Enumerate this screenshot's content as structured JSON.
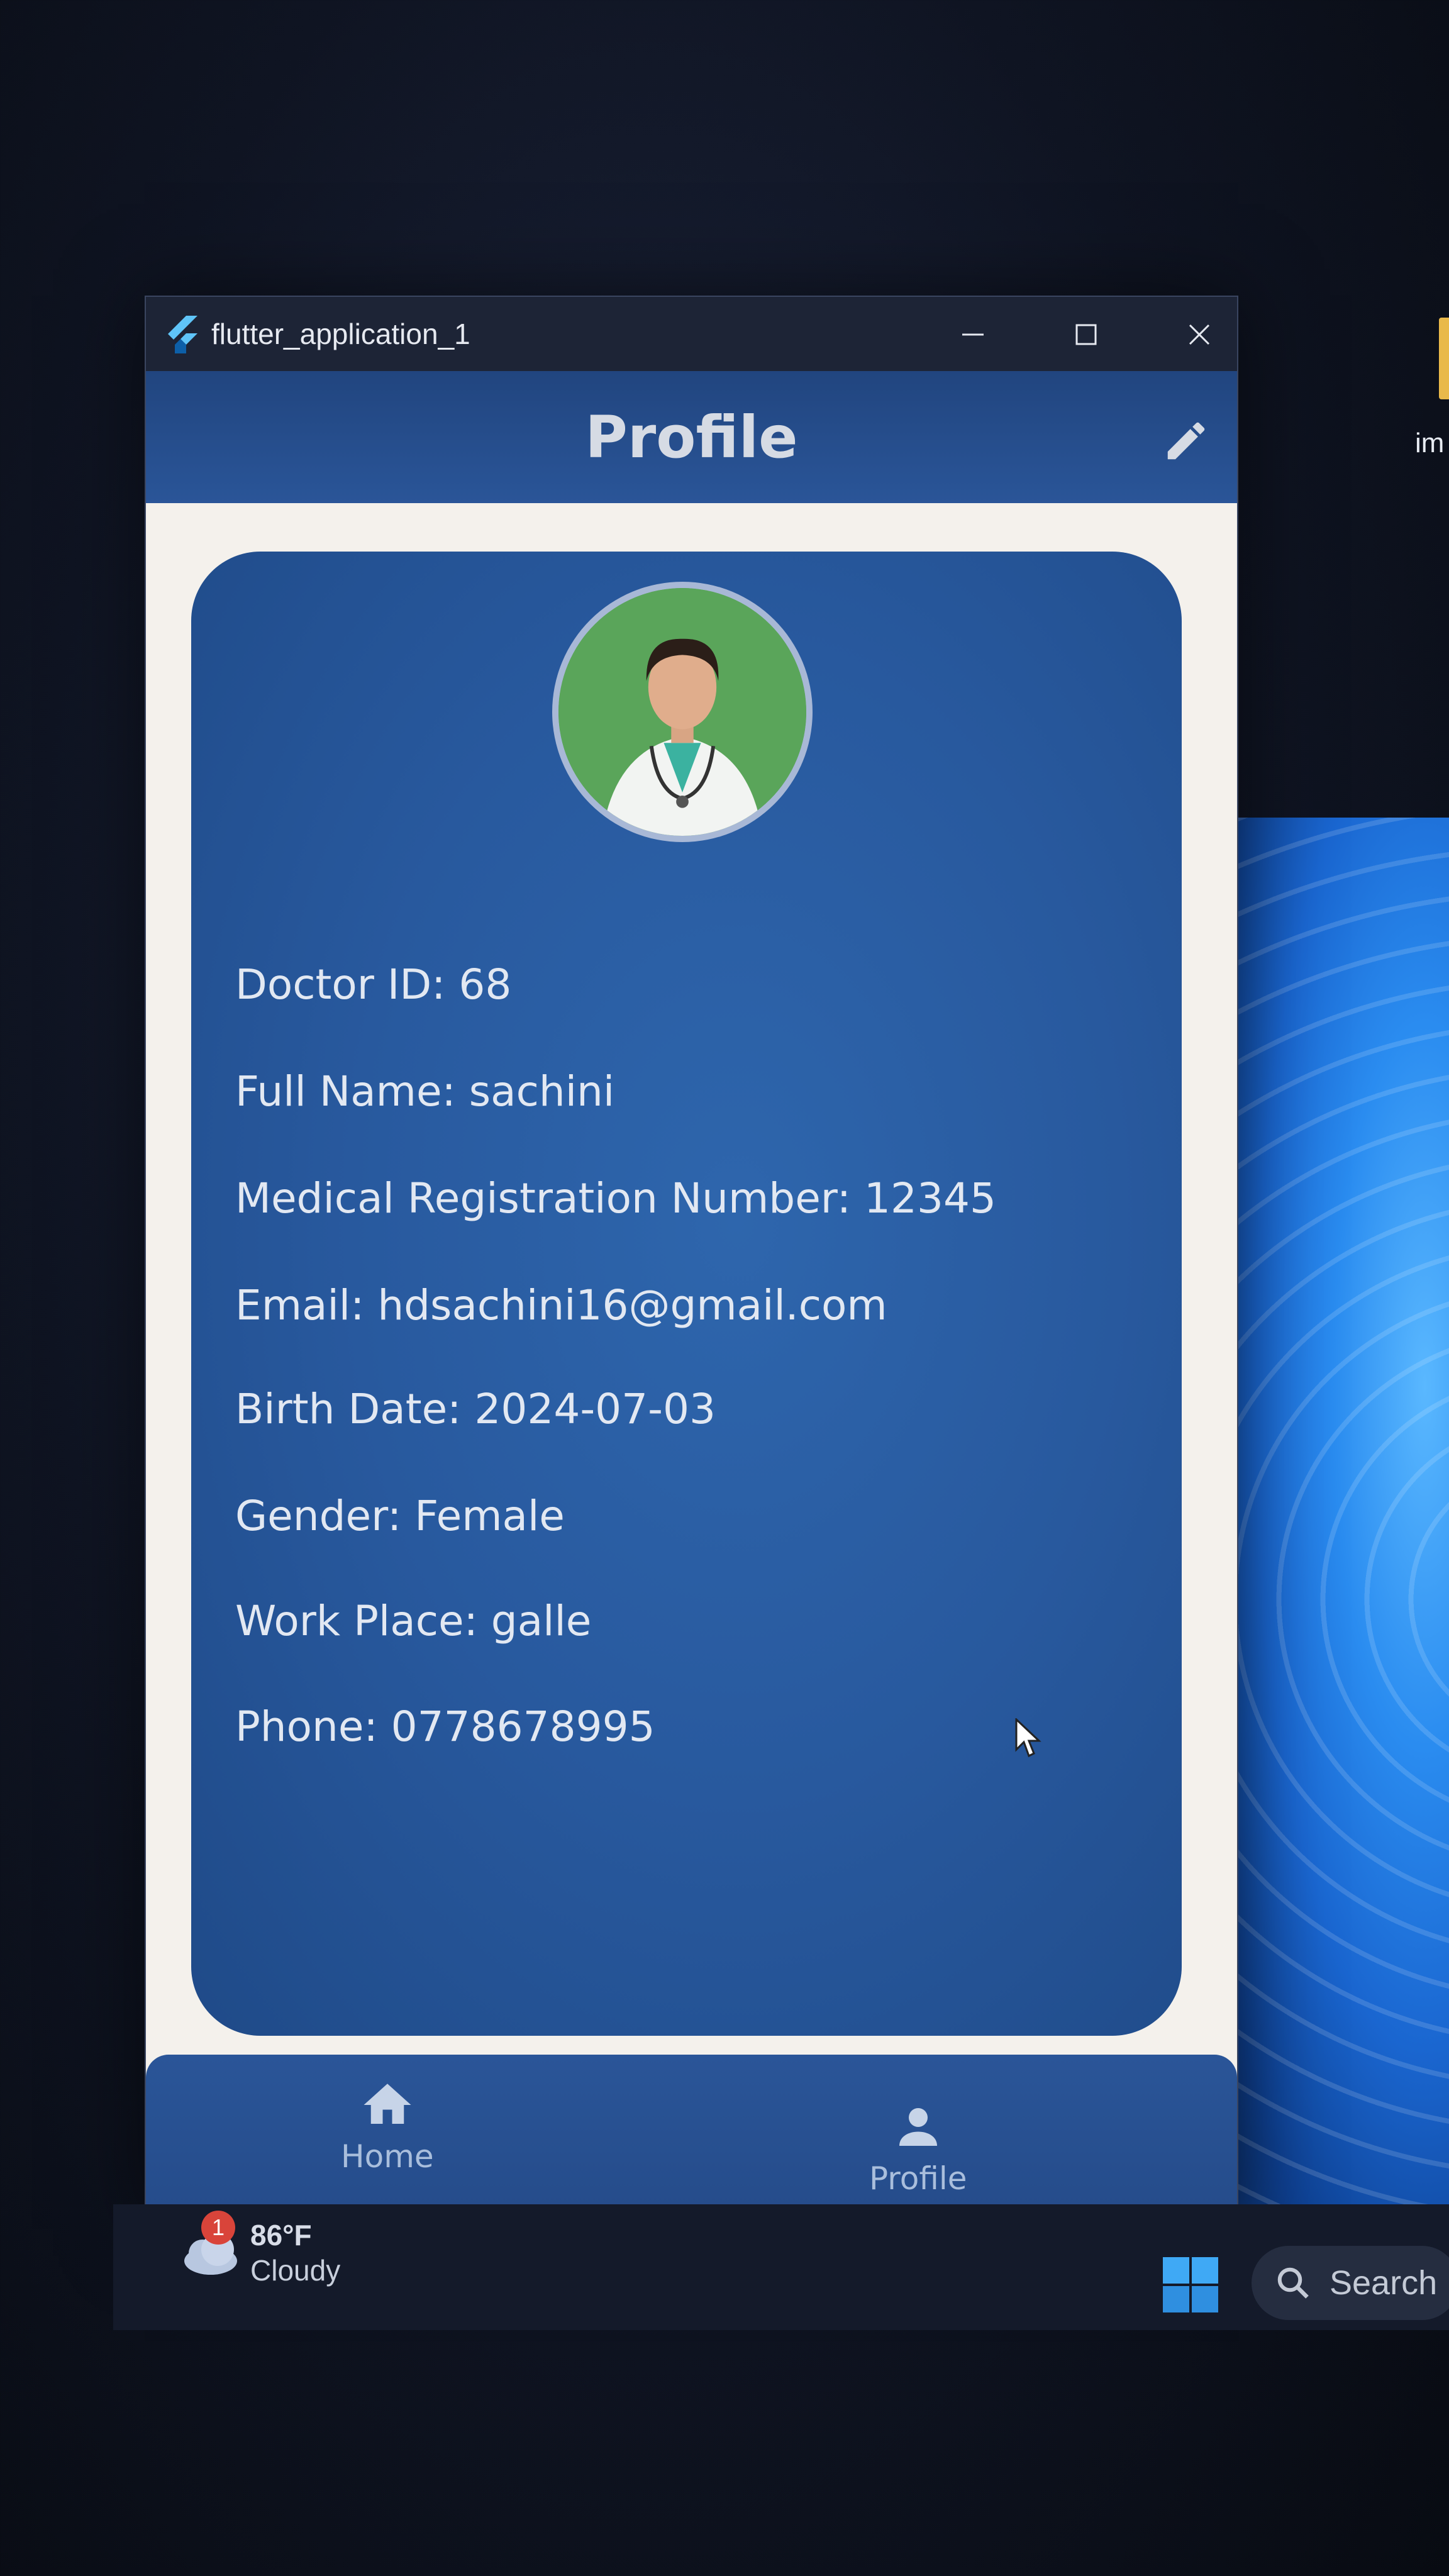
{
  "desktop": {
    "icon_label": "im"
  },
  "window": {
    "title": "flutter_application_1"
  },
  "appbar": {
    "title": "Profile",
    "edit_icon": "edit-icon"
  },
  "profile": {
    "fields": [
      {
        "label": "Doctor ID: 68"
      },
      {
        "label": "Full Name: sachini"
      },
      {
        "label": "Medical Registration Number: 12345"
      },
      {
        "label": "Email: hdsachini16@gmail.com"
      },
      {
        "label": "Birth Date: 2024-07-03"
      },
      {
        "label": "Gender: Female"
      },
      {
        "label": "Work Place: galle"
      },
      {
        "label": "Phone: 0778678995"
      }
    ]
  },
  "bottom_nav": {
    "items": [
      {
        "label": "Home",
        "icon": "home-icon"
      },
      {
        "label": "Profile",
        "icon": "person-icon"
      }
    ]
  },
  "taskbar": {
    "weather": {
      "temp": "86°F",
      "condition": "Cloudy",
      "badge": "1"
    },
    "search_label": "Search"
  },
  "colors": {
    "appbar": "#2a5598",
    "card": "#28599e",
    "text": "#e2e8f2",
    "page_bg": "#f4f1ec"
  }
}
